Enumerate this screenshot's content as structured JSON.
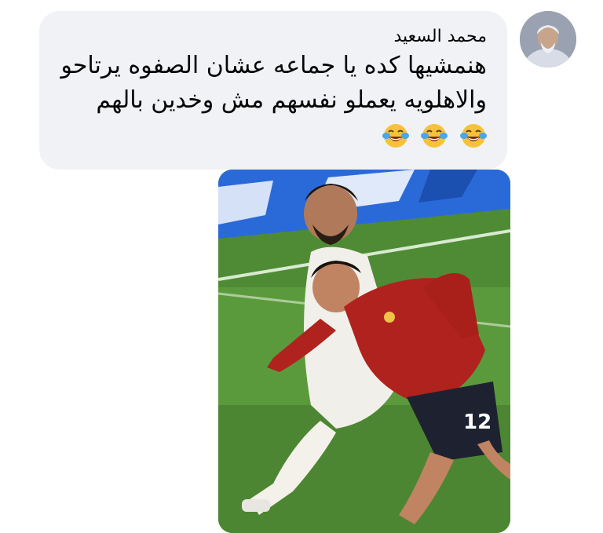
{
  "comment": {
    "author_name": "محمد السعيد",
    "text": "هنمشيها كده يا جماعه عشان الصفوه يرتاحو والاهلويه يعملو نفسهم مش وخدين بالهم",
    "emoji": [
      "face-with-tears-of-joy",
      "face-with-tears-of-joy",
      "face-with-tears-of-joy"
    ]
  },
  "attachment": {
    "type": "photo",
    "jersey_number": "12"
  }
}
